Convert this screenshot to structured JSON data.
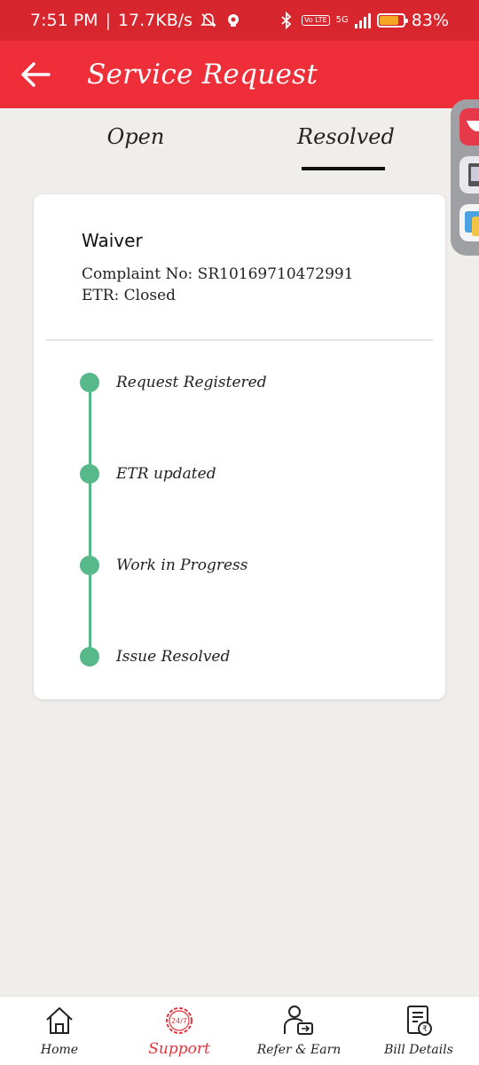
{
  "status_bar": {
    "time": "7:51 PM",
    "separator": "|",
    "network_speed": "17.7KB/s",
    "volte_label": "Vo LTE",
    "network_type": "5G",
    "battery_percent": "83%",
    "battery_level": 0.83,
    "icons": [
      "mute-notifications-icon",
      "app-notification-icon",
      "bluetooth-icon",
      "signal-icon",
      "battery-icon"
    ]
  },
  "app_bar": {
    "title": "Service Request",
    "back_icon": "arrow-left-icon",
    "color": "#ee2f3a"
  },
  "tabs": [
    {
      "label": "Open",
      "selected": false
    },
    {
      "label": "Resolved",
      "selected": true
    }
  ],
  "request": {
    "title": "Waiver",
    "complaint": "Complaint No: SR10169710472991",
    "etr": "ETR: Closed"
  },
  "timeline": {
    "color": "#57b98a",
    "steps": [
      {
        "label": "Request Registered"
      },
      {
        "label": "ETR updated"
      },
      {
        "label": "Work in Progress"
      },
      {
        "label": "Issue Resolved"
      }
    ]
  },
  "bottom_nav": {
    "active_color": "#e3353d",
    "items": [
      {
        "label": "Home",
        "icon": "home-icon"
      },
      {
        "label": "Support",
        "icon": "support-24-7-icon",
        "badge": "24/7",
        "active": true
      },
      {
        "label": "Refer & Earn",
        "icon": "refer-earn-icon"
      },
      {
        "label": "Bill Details",
        "icon": "bill-details-icon"
      }
    ]
  }
}
